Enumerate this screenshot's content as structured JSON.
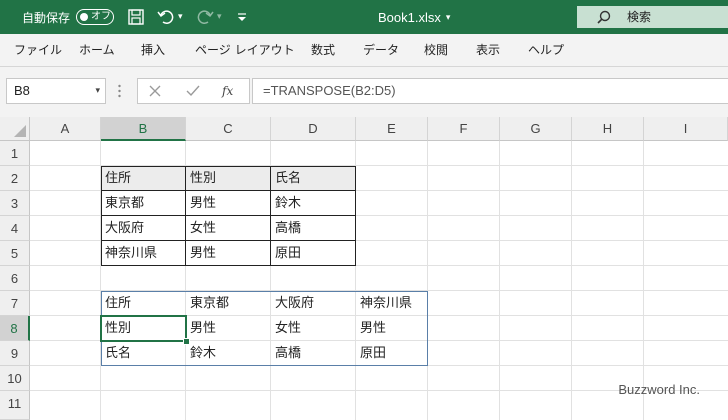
{
  "titlebar": {
    "autosave_label": "自動保存",
    "autosave_state": "オフ",
    "filename": "Book1.xlsx",
    "search_label": "検索",
    "bg_color": "#217346"
  },
  "menu": [
    "ファイル",
    "ホーム",
    "挿入",
    "ページ レイアウト",
    "数式",
    "データ",
    "校閲",
    "表示",
    "ヘルプ"
  ],
  "formula_bar": {
    "name_box": "B8",
    "fx": "fx",
    "formula": "=TRANSPOSE(B2:D5)"
  },
  "columns": [
    "A",
    "B",
    "C",
    "D",
    "E",
    "F",
    "G",
    "H",
    "I"
  ],
  "rows": [
    "1",
    "2",
    "3",
    "4",
    "5",
    "6",
    "7",
    "8",
    "9",
    "10",
    "11"
  ],
  "source_table": [
    [
      "住所",
      "性別",
      "氏名"
    ],
    [
      "東京都",
      "男性",
      "鈴木"
    ],
    [
      "大阪府",
      "女性",
      "高橋"
    ],
    [
      "神奈川県",
      "男性",
      "原田"
    ]
  ],
  "transposed_table": [
    [
      "住所",
      "東京都",
      "大阪府",
      "神奈川県"
    ],
    [
      "性別",
      "男性",
      "女性",
      "男性"
    ],
    [
      "氏名",
      "鈴木",
      "高橋",
      "原田"
    ]
  ],
  "watermark": "Buzzword Inc."
}
